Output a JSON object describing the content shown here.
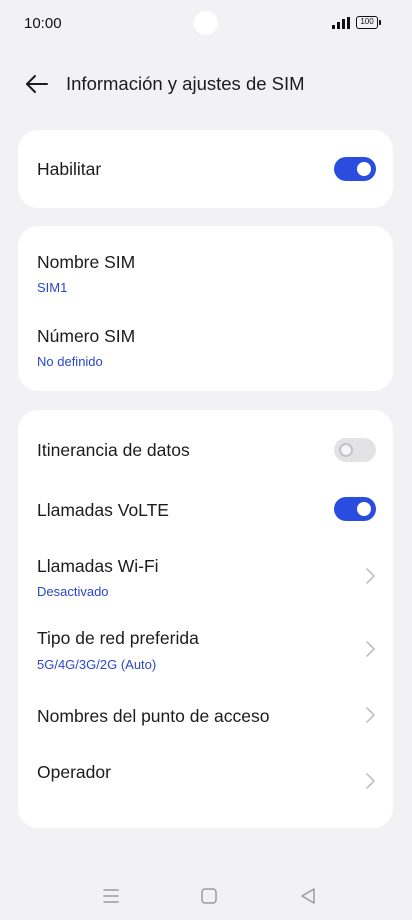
{
  "status_bar": {
    "time": "10:00",
    "battery_level": "100",
    "icons": [
      "signal-icon",
      "battery-icon"
    ]
  },
  "header": {
    "back_icon": "arrow-left-icon",
    "title": "Información y ajustes de SIM"
  },
  "card_enable": {
    "label": "Habilitar",
    "toggle_on": true
  },
  "card_sim": {
    "name_label": "Nombre SIM",
    "name_value": "SIM1",
    "number_label": "Número SIM",
    "number_value": "No definido"
  },
  "card_network": {
    "roaming": {
      "label": "Itinerancia de datos",
      "toggle_on": false
    },
    "volte": {
      "label": "Llamadas VoLTE",
      "toggle_on": true
    },
    "wifi_calling": {
      "label": "Llamadas Wi-Fi",
      "value": "Desactivado"
    },
    "network_type": {
      "label": "Tipo de red preferida",
      "value": "5G/4G/3G/2G (Auto)"
    },
    "apn": {
      "label": "Nombres del punto de acceso"
    },
    "operator": {
      "label": "Operador"
    }
  },
  "nav_bar": {
    "icons": [
      "menu-icon",
      "home-icon",
      "back-triangle-icon"
    ]
  },
  "colors": {
    "accent": "#2a4de0",
    "subtitle": "#2a47c8",
    "background": "#f2f2f4",
    "card": "#ffffff"
  }
}
